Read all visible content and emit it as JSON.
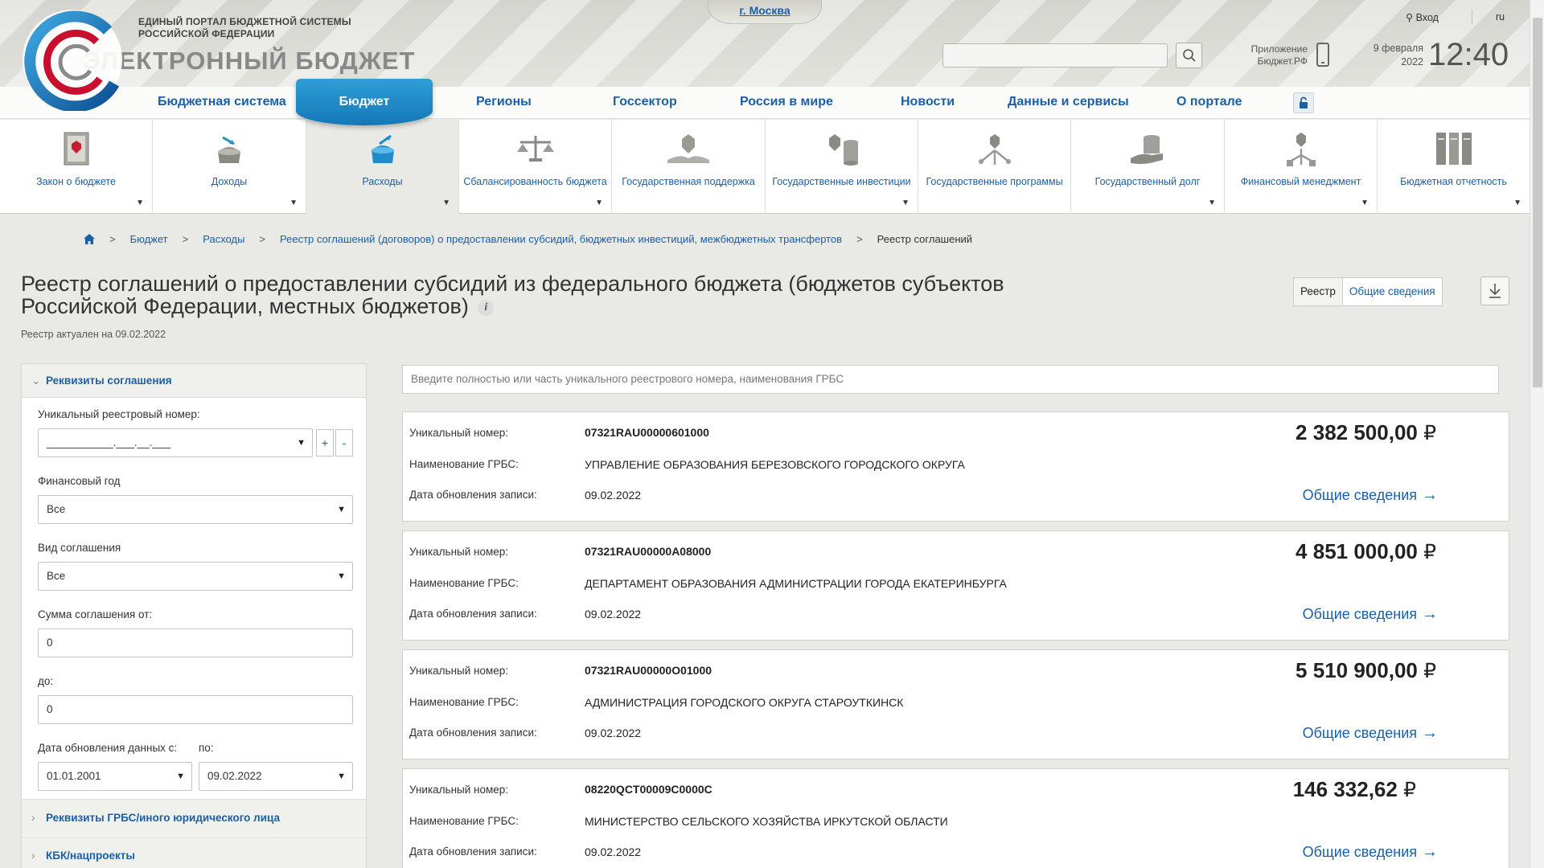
{
  "header": {
    "logo_subtitle_1": "ЕДИНЫЙ ПОРТАЛ БЮДЖЕТНОЙ СИСТЕМЫ",
    "logo_subtitle_2": "РОССИЙСКОЙ ФЕДЕРАЦИИ",
    "logo_title": "ЭЛЕКТРОННЫЙ БЮДЖЕТ",
    "city": "г. Москва",
    "login": "Вход",
    "lang": "ru",
    "app_line1": "Приложение",
    "app_line2": "Бюджет.РФ",
    "date_line1": "9 февраля",
    "date_line2": "2022",
    "time": "12:40",
    "search_value": ""
  },
  "topnav": {
    "items": [
      "Бюджетная система",
      "Бюджет",
      "Регионы",
      "Госсектор",
      "Россия в мире",
      "Новости",
      "Данные и сервисы",
      "О портале"
    ],
    "active_index": 1
  },
  "categories": [
    {
      "label": "Закон о бюджете",
      "icon": "law-book-icon",
      "has_menu": true
    },
    {
      "label": "Доходы",
      "icon": "income-icon",
      "has_menu": true
    },
    {
      "label": "Расходы",
      "icon": "expenses-icon",
      "has_menu": true,
      "active": true
    },
    {
      "label": "Сбалансированность бюджета",
      "icon": "balance-scale-icon",
      "has_menu": true
    },
    {
      "label": "Государственная поддержка",
      "icon": "state-support-icon",
      "has_menu": true
    },
    {
      "label": "Государственные инвестиции",
      "icon": "investments-icon",
      "has_menu": true
    },
    {
      "label": "Государственные программы",
      "icon": "programs-icon",
      "has_menu": false
    },
    {
      "label": "Государственный долг",
      "icon": "debt-icon",
      "has_menu": true
    },
    {
      "label": "Финансовый менеджмент",
      "icon": "financial-management-icon",
      "has_menu": true
    },
    {
      "label": "Бюджетная отчетность",
      "icon": "reporting-icon",
      "has_menu": true
    }
  ],
  "breadcrumb": {
    "items": [
      "Бюджет",
      "Расходы",
      "Реестр соглашений (договоров) о предоставлении субсидий, бюджетных инвестиций, межбюджетных трансфертов"
    ],
    "current": "Реестр соглашений"
  },
  "page": {
    "title": "Реестр соглашений о предоставлении субсидий из федерального бюджета (бюджетов субъектов Российской Федерации, местных бюджетов)",
    "updated": "Реестр актуален на 09.02.2022",
    "view_registry": "Реестр",
    "view_general": "Общие сведения"
  },
  "filter": {
    "section_title": "Реквизиты соглашения",
    "registry_number_label": "Уникальный реестровый номер:",
    "registry_number_value": "___________.___.__.___",
    "plus": "+",
    "minus": "-",
    "fin_year_label": "Финансовый год",
    "fin_year_value": "Все",
    "agreement_type_label": "Вид соглашения",
    "agreement_type_value": "Все",
    "sum_from_label": "Сумма соглашения от:",
    "sum_from_value": "0",
    "sum_to_label": "до:",
    "sum_to_value": "0",
    "date_from_label": "Дата обновления данных с:",
    "date_to_label": "по:",
    "date_from_value": "01.01.2001",
    "date_to_value": "09.02.2022",
    "section_grbs": "Реквизиты ГРБС/иного юридического лица",
    "section_kbk": "КБК/нацпроекты"
  },
  "results": {
    "search_placeholder": "Введите полностью или часть уникального реестрового номера, наименования ГРБС",
    "labels": {
      "number": "Уникальный номер:",
      "grbs": "Наименование ГРБС:",
      "date": "Дата обновления записи:",
      "link": "Общие сведения",
      "currency": "₽"
    },
    "items": [
      {
        "number": "07321RAU00000601000",
        "grbs": "УПРАВЛЕНИЕ ОБРАЗОВАНИЯ БЕРЕЗОВСКОГО ГОРОДСКОГО ОКРУГА",
        "date": "09.02.2022",
        "amount": "2 382 500,00"
      },
      {
        "number": "07321RAU00000A08000",
        "grbs": "ДЕПАРТАМЕНТ ОБРАЗОВАНИЯ АДМИНИСТРАЦИИ ГОРОДА ЕКАТЕРИНБУРГА",
        "date": "09.02.2022",
        "amount": "4 851 000,00"
      },
      {
        "number": "07321RAU00000O01000",
        "grbs": "АДМИНИСТРАЦИЯ ГОРОДСКОГО ОКРУГА СТАРОУТКИНСК",
        "date": "09.02.2022",
        "amount": "5 510 900,00"
      },
      {
        "number": "08220QCT00009C0000C",
        "grbs": "МИНИСТЕРСТВО СЕЛЬСКОГО ХОЗЯЙСТВА ИРКУТСКОЙ ОБЛАСТИ",
        "date": "09.02.2022",
        "amount": "146 332,62"
      }
    ]
  },
  "colors": {
    "accent": "#1a5fa8",
    "active_tab": "#1f8bc9"
  }
}
